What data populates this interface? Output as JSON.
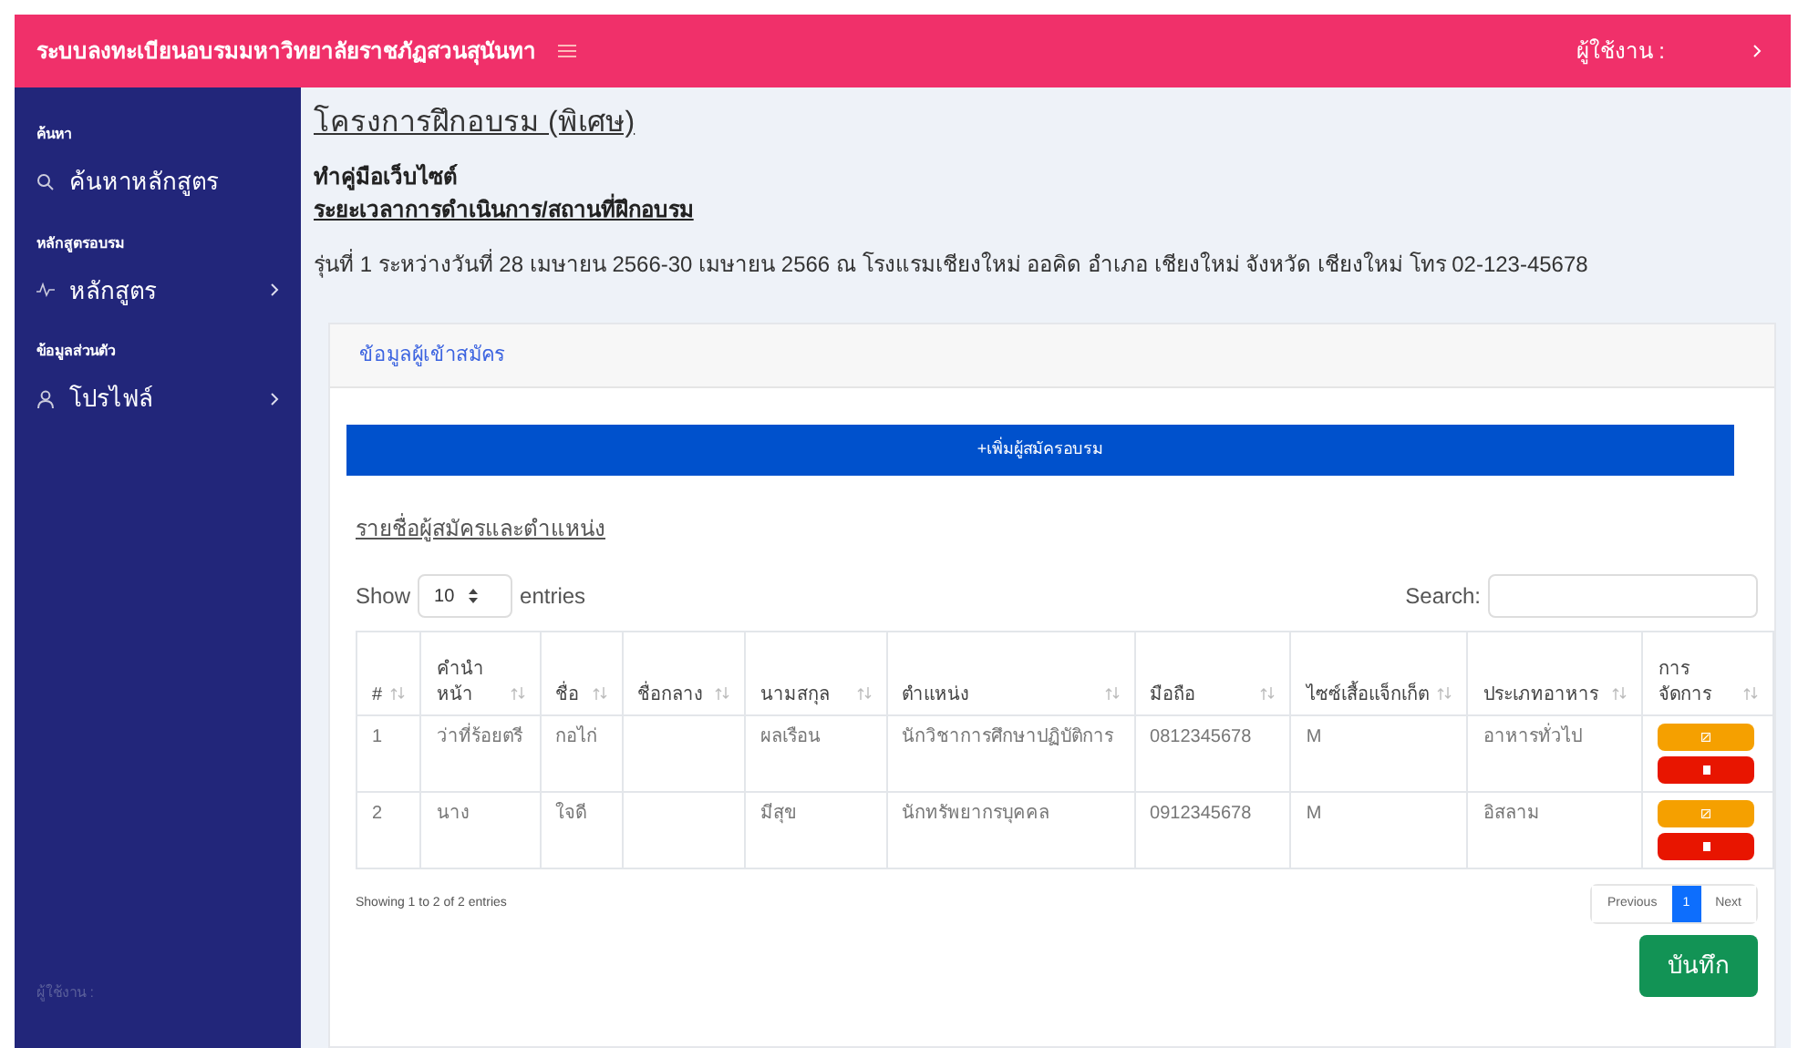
{
  "topbar": {
    "title": "ระบบลงทะเบียนอบรมมหาวิทยาลัยราชภัฏสวนสุนันทา",
    "user_label": "ผู้ใช้งาน :"
  },
  "sidebar": {
    "sections": [
      {
        "heading": "ค้นหา",
        "items": [
          {
            "label": "ค้นหาหลักสูตร",
            "kind": "search",
            "has_submenu": false
          }
        ]
      },
      {
        "heading": "หลักสูตรอบรม",
        "items": [
          {
            "label": "หลักสูตร",
            "kind": "pulse",
            "has_submenu": true
          }
        ]
      },
      {
        "heading": "ข้อมูลส่วนตัว",
        "items": [
          {
            "label": "โปรไฟล์",
            "kind": "user",
            "has_submenu": true
          }
        ]
      }
    ],
    "footer": "ผู้ใช้งาน :"
  },
  "page": {
    "title": "โครงการฝึกอบรม (พิเศษ)",
    "manual_link": "ทำคู่มือเว็บไซต์",
    "schedule_link": "ระยะเวลาการดำเนินการ/สถานที่ฝึกอบรม",
    "session_info": "รุ่นที่ 1 ระหว่างวันที่ 28 เมษายน 2566-30 เมษายน 2566 ณ โรงแรมเชียงใหม่ ออคิด อำเภอ เชียงใหม่ จังหวัด เชียงใหม่ โทร 02-123-45678"
  },
  "card": {
    "title": "ข้อมูลผู้เข้าสมัคร",
    "add_button": "+เพิ่มผู้สมัครอบรม",
    "list_link": "รายชื่อผู้สมัครและตำแหน่ง",
    "show_label": "Show",
    "page_size": "10",
    "entries_label": "entries",
    "search_label": "Search:",
    "table": {
      "columns": [
        "#",
        "คำนำหน้า",
        "ชื่อ",
        "ชื่อกลาง",
        "นามสกุล",
        "ตำแหน่ง",
        "มือถือ",
        "ไซซ์เสื้อแจ็กเก็ต",
        "ประเภทอาหาร",
        "การจัดการ"
      ],
      "rows": [
        [
          "1",
          "ว่าที่ร้อยตรี",
          "กอไก่",
          "",
          "ผลเรือน",
          "นักวิชาการศึกษาปฏิบัติการ",
          "0812345678",
          "M",
          "อาหารทั่วไป"
        ],
        [
          "2",
          "นาง",
          "ใจดี",
          "",
          "มีสุข",
          "นักทรัพยากรบุคคล",
          "0912345678",
          "M",
          "อิสลาม"
        ]
      ]
    },
    "info": "Showing 1 to 2 of 2 entries",
    "pagination": [
      {
        "label": "Previous",
        "selected": false
      },
      {
        "label": "1",
        "selected": true
      },
      {
        "label": "Next",
        "selected": false
      }
    ],
    "save_button": "บันทึก"
  }
}
